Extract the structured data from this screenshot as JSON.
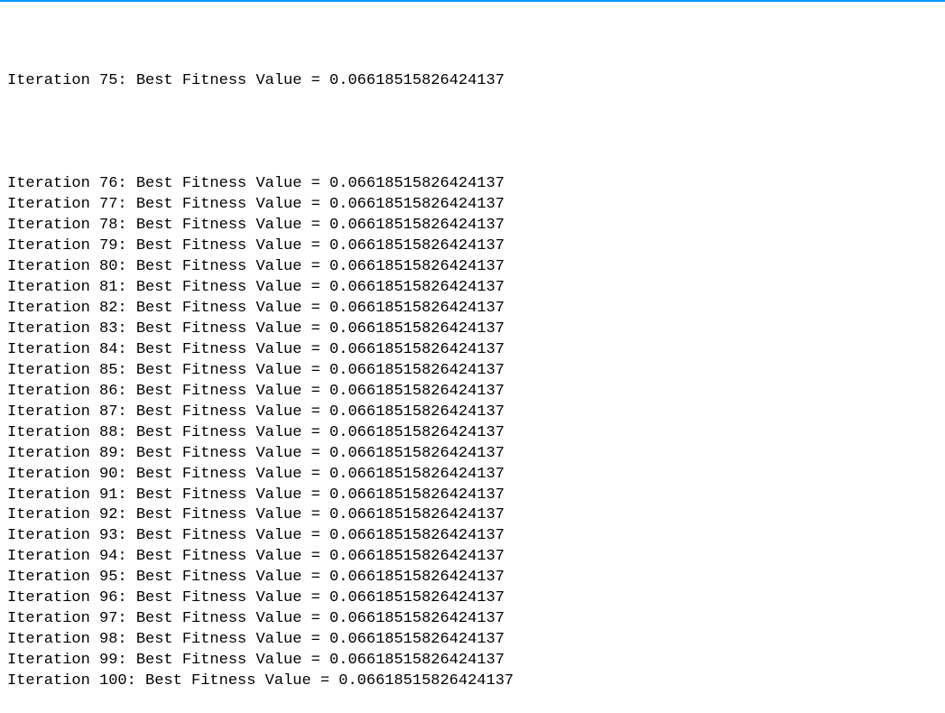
{
  "output": {
    "label_prefix": "Iteration",
    "label_middle": "Best Fitness Value",
    "equals": "=",
    "lines": [
      {
        "iter": 75,
        "value": "0.06618515826424137"
      },
      {
        "iter": 76,
        "value": "0.06618515826424137"
      },
      {
        "iter": 77,
        "value": "0.06618515826424137"
      },
      {
        "iter": 78,
        "value": "0.06618515826424137"
      },
      {
        "iter": 79,
        "value": "0.06618515826424137"
      },
      {
        "iter": 80,
        "value": "0.06618515826424137"
      },
      {
        "iter": 81,
        "value": "0.06618515826424137"
      },
      {
        "iter": 82,
        "value": "0.06618515826424137"
      },
      {
        "iter": 83,
        "value": "0.06618515826424137"
      },
      {
        "iter": 84,
        "value": "0.06618515826424137"
      },
      {
        "iter": 85,
        "value": "0.06618515826424137"
      },
      {
        "iter": 86,
        "value": "0.06618515826424137"
      },
      {
        "iter": 87,
        "value": "0.06618515826424137"
      },
      {
        "iter": 88,
        "value": "0.06618515826424137"
      },
      {
        "iter": 89,
        "value": "0.06618515826424137"
      },
      {
        "iter": 90,
        "value": "0.06618515826424137"
      },
      {
        "iter": 91,
        "value": "0.06618515826424137"
      },
      {
        "iter": 92,
        "value": "0.06618515826424137"
      },
      {
        "iter": 93,
        "value": "0.06618515826424137"
      },
      {
        "iter": 94,
        "value": "0.06618515826424137"
      },
      {
        "iter": 95,
        "value": "0.06618515826424137"
      },
      {
        "iter": 96,
        "value": "0.06618515826424137"
      },
      {
        "iter": 97,
        "value": "0.06618515826424137"
      },
      {
        "iter": 98,
        "value": "0.06618515826424137"
      },
      {
        "iter": 99,
        "value": "0.06618515826424137"
      },
      {
        "iter": 100,
        "value": "0.06618515826424137"
      }
    ]
  }
}
